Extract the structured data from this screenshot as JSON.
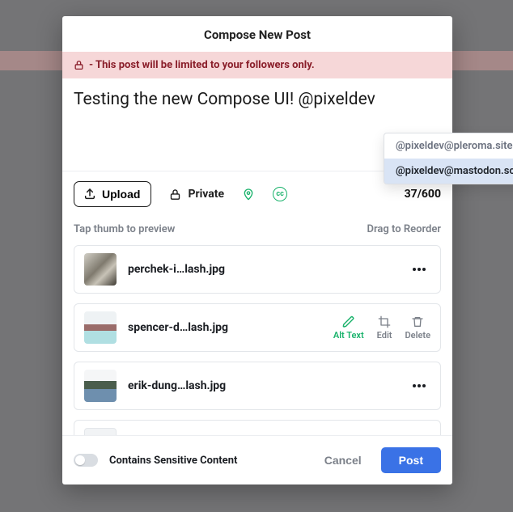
{
  "modal": {
    "title": "Compose New Post"
  },
  "banner": {
    "text": "- This post will be limited to your followers only."
  },
  "compose": {
    "text": "Testing the new Compose UI! @pixeldev",
    "char_count": "37/600"
  },
  "suggestions": [
    {
      "handle": "@pixeldev@pleroma.site",
      "selected": false
    },
    {
      "handle": "@pixeldev@mastodon.social",
      "selected": true
    }
  ],
  "toolbar": {
    "upload_label": "Upload",
    "privacy_label": "Private",
    "cc_label": "cc"
  },
  "attachments": {
    "hint_left": "Tap thumb to preview",
    "hint_right": "Drag to Reorder",
    "files": [
      {
        "name": "perchek-i…lash.jpg",
        "style": "thumb-1",
        "expanded": false
      },
      {
        "name": "spencer-d…lash.jpg",
        "style": "thumb-2",
        "expanded": true
      },
      {
        "name": "erik-dung…lash.jpg",
        "style": "thumb-3",
        "expanded": false
      },
      {
        "name": "",
        "style": "thumb-4",
        "expanded": false
      }
    ],
    "actions": {
      "alt_text": "Alt Text",
      "edit": "Edit",
      "delete": "Delete"
    }
  },
  "footer": {
    "sensitive_label": "Contains Sensitive Content",
    "cancel_label": "Cancel",
    "post_label": "Post"
  }
}
